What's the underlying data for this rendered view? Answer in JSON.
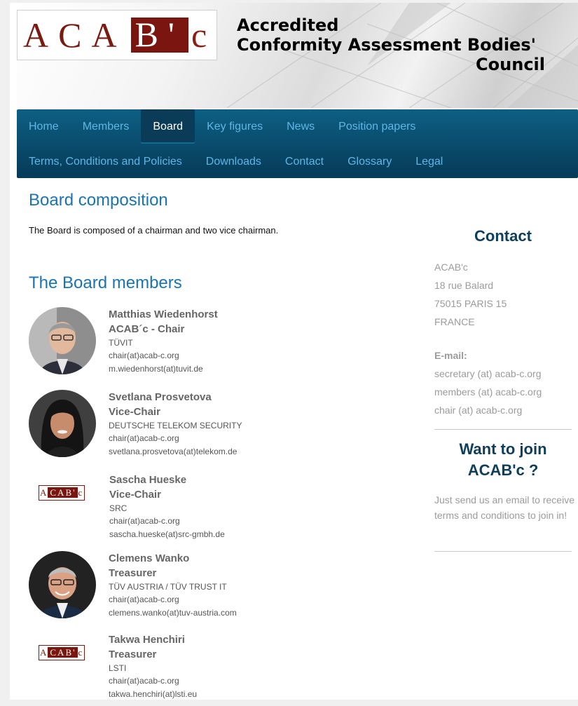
{
  "header": {
    "logo": {
      "left": "ACA",
      "right": "B'",
      "suffix": "c"
    },
    "title_line1": "Accredited",
    "title_line2": "Conformity Assessment Bodies'",
    "title_line3": "Council"
  },
  "nav": {
    "row1": [
      "Home",
      "Members",
      "Board",
      "Key figures",
      "News",
      "Position papers"
    ],
    "row2": [
      "Terms, Conditions and Policies",
      "Downloads",
      "Contact",
      "Glossary",
      "Legal"
    ],
    "active": "Board"
  },
  "main": {
    "heading": "Board composition",
    "intro": "The Board is composed of a chairman and two vice chairman.",
    "members_heading": "The Board members",
    "members": [
      {
        "name": "Matthias Wiedenhorst",
        "role": "ACAB´c - Chair",
        "org": "TÜVIT",
        "email1": "chair(at)acab-c.org",
        "email2": "m.wiedenhorst(at)tuvit.de",
        "photo": "portrait-man-glasses-icon"
      },
      {
        "name": "Svetlana Prosvetova",
        "role": "Vice-Chair",
        "org": "DEUTSCHE TELEKOM SECURITY",
        "email1": "chair(at)acab-c.org",
        "email2": "svetlana.prosvetova(at)telekom.de",
        "photo": "portrait-woman-icon"
      },
      {
        "name": "Sascha Hueske",
        "role": "Vice-Chair",
        "org": "SRC",
        "email1": "chair(at)acab-c.org",
        "email2": "sascha.hueske(at)src-gmbh.de",
        "photo": "acabc-logo-icon"
      },
      {
        "name": "Clemens Wanko",
        "role": "Treasurer",
        "org": "TÜV AUSTRIA / TÜV TRUST IT",
        "email1": "chair(at)acab-c.org",
        "email2": "clemens.wanko(at)tuv-austria.com",
        "photo": "portrait-man-glasses-icon"
      },
      {
        "name": "Takwa Henchiri",
        "role": "Treasurer",
        "org": "LSTI",
        "email1": "chair(at)acab-c.org",
        "email2": "takwa.henchiri(at)lsti.eu",
        "photo": "acabc-logo-icon"
      }
    ]
  },
  "sidebar": {
    "contact_title": "Contact",
    "address": [
      "ACAB'c",
      "18 rue Balard",
      "75015 PARIS 15",
      "FRANCE"
    ],
    "email_label": "E-mail:",
    "emails": [
      "secretary (at) acab-c.org",
      "members (at) acab-c.org",
      "chair (at) acab-c.org"
    ],
    "join_title_line1": "Want to join",
    "join_title_line2": "ACAB'c ?",
    "join_text": "Just send us an email to receive terms and conditions to join in!"
  },
  "colors": {
    "accent_blue": "#1a74b0",
    "nav_dark": "#063a58",
    "nav_link": "#5fb6e6",
    "brand_red": "#7b150f"
  }
}
